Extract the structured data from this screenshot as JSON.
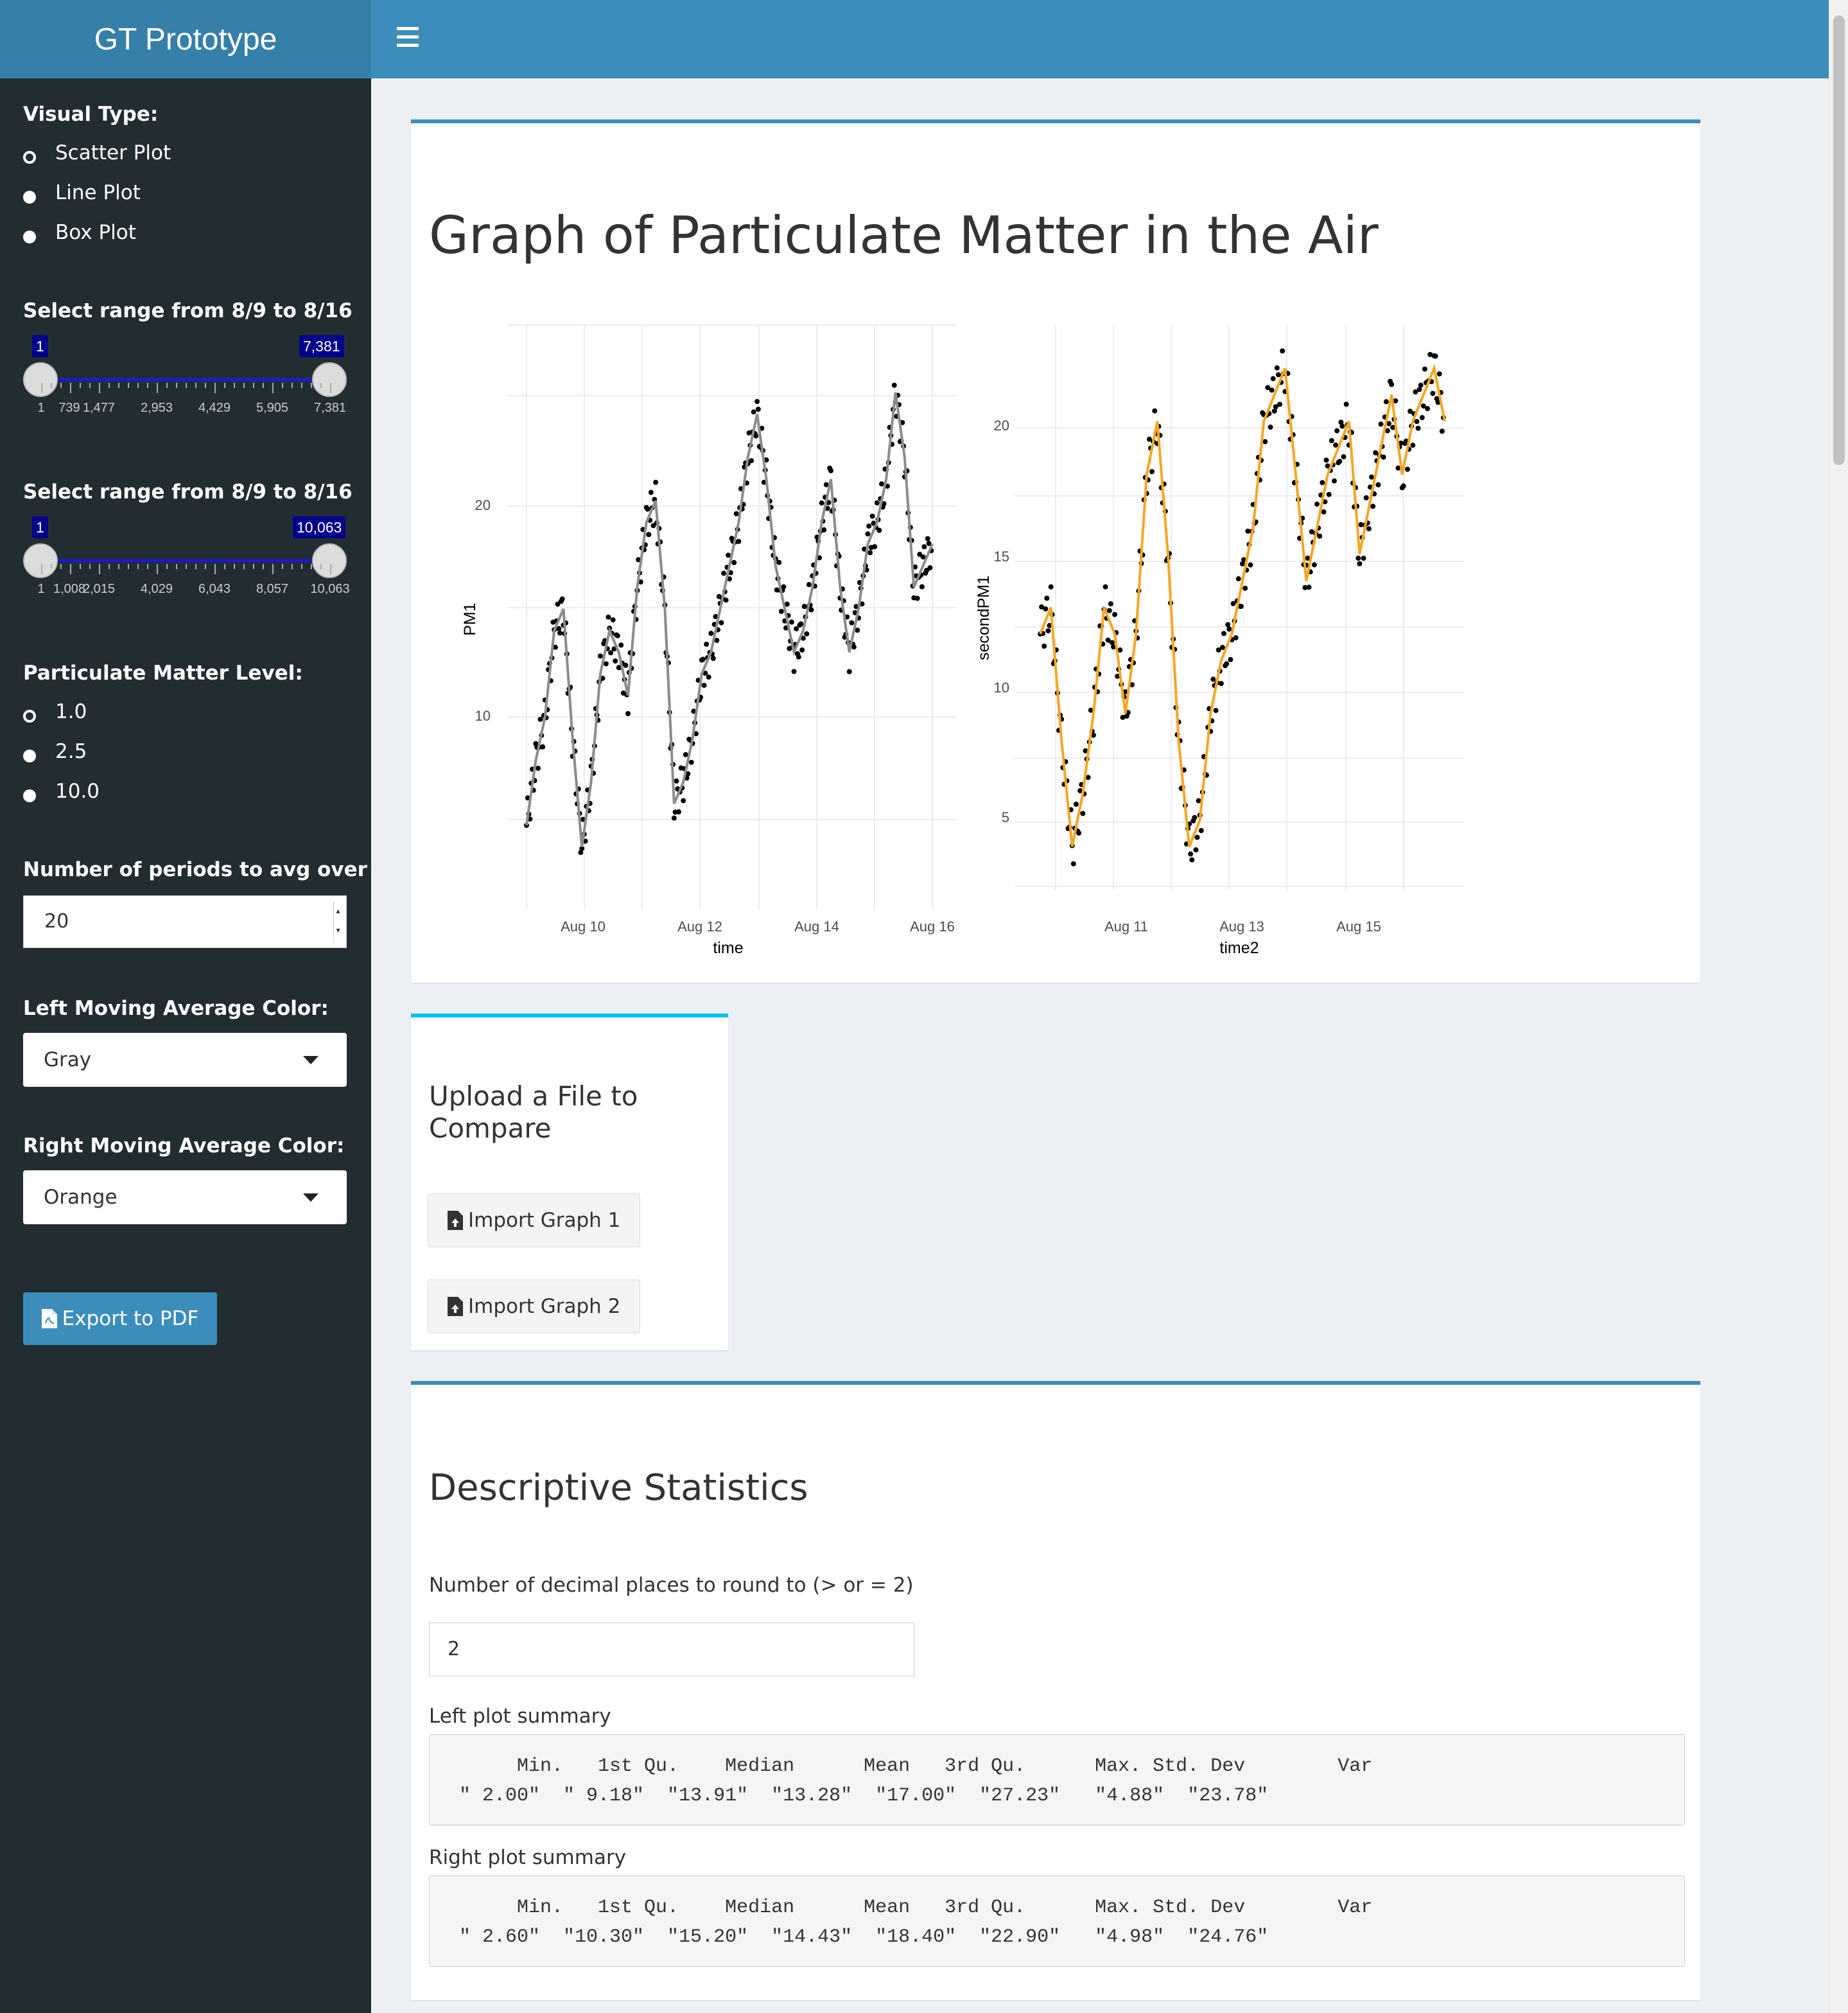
{
  "header": {
    "brand": "GT Prototype",
    "menu_icon": "hamburger-icon"
  },
  "sidebar": {
    "visual_type": {
      "label": "Visual Type:",
      "options": [
        "Scatter Plot",
        "Line Plot",
        "Box Plot"
      ],
      "selected": "Scatter Plot"
    },
    "range1": {
      "label": "Select range from 8/9 to 8/16",
      "min": "1",
      "max": "7,381",
      "ticks": [
        "1",
        "739",
        "1,477",
        "2,953",
        "4,429",
        "5,905",
        "7,381"
      ]
    },
    "range2": {
      "label": "Select range from 8/9 to 8/16",
      "min": "1",
      "max": "10,063",
      "ticks": [
        "1",
        "1,008",
        "2,015",
        "4,029",
        "6,043",
        "8,057",
        "10,063"
      ]
    },
    "pm_level": {
      "label": "Particulate Matter Level:",
      "options": [
        "1.0",
        "2.5",
        "10.0"
      ],
      "selected": "1.0"
    },
    "periods": {
      "label": "Number of periods to avg over",
      "value": "20"
    },
    "left_color": {
      "label": "Left Moving Average Color:",
      "value": "Gray"
    },
    "right_color": {
      "label": "Right Moving Average Color:",
      "value": "Orange"
    },
    "export_button": "Export to PDF"
  },
  "graph_box": {
    "title": "Graph of Particulate Matter in the Air",
    "left_plot": {
      "ylabel": "PM1",
      "xlabel": "time",
      "yticks": [
        "10",
        "20"
      ],
      "xticks": [
        "Aug 10",
        "Aug 12",
        "Aug 14",
        "Aug 16"
      ]
    },
    "right_plot": {
      "ylabel": "secondPM1",
      "xlabel": "time2",
      "yticks": [
        "5",
        "10",
        "15",
        "20"
      ],
      "xticks": [
        "Aug 11",
        "Aug 13",
        "Aug 15"
      ]
    }
  },
  "chart_data": [
    {
      "type": "scatter",
      "xlabel": "time",
      "ylabel": "PM1",
      "x_range": [
        "Aug 9",
        "Aug 16"
      ],
      "ylim": [
        2,
        27.23
      ],
      "series": [
        {
          "values": [
            5,
            8,
            10,
            14,
            15,
            9,
            4,
            7,
            12,
            14,
            13,
            11,
            16,
            19,
            20,
            15,
            6,
            7,
            9,
            12,
            13,
            15,
            17,
            19,
            22,
            24,
            21,
            17,
            15,
            13,
            14,
            16,
            19,
            21,
            16,
            13,
            15,
            18,
            19,
            21,
            25,
            22,
            16,
            17,
            18
          ]
        }
      ],
      "moving_average_color": "Gray"
    },
    {
      "type": "scatter",
      "xlabel": "time2",
      "ylabel": "secondPM1",
      "x_range": [
        "Aug 10",
        "Aug 16"
      ],
      "ylim": [
        2.6,
        22.9
      ],
      "series": [
        {
          "values": [
            12,
            13,
            8,
            4,
            6,
            9,
            13,
            12,
            9,
            12,
            18,
            20,
            15,
            8,
            4,
            5,
            9,
            11,
            12,
            14,
            16,
            20,
            21,
            22,
            18,
            14,
            16,
            18,
            19,
            20,
            15,
            17,
            19,
            21,
            18,
            20,
            21,
            22,
            20
          ]
        }
      ],
      "moving_average_color": "Orange"
    }
  ],
  "upload_box": {
    "title": "Upload a File to Compare",
    "button1": "Import Graph 1",
    "button2": "Import Graph 2"
  },
  "stats_box": {
    "title": "Descriptive Statistics",
    "round_label": "Number of decimal places to round to (> or = 2)",
    "round_value": "2",
    "left_label": "Left plot summary",
    "left_header": "     Min.   1st Qu.    Median      Mean   3rd Qu.      Max. Std. Dev        Var",
    "left_values": "\" 2.00\"  \" 9.18\"  \"13.91\"  \"13.28\"  \"17.00\"  \"27.23\"   \"4.88\"  \"23.78\"",
    "right_label": "Right plot summary",
    "right_header": "     Min.   1st Qu.    Median      Mean   3rd Qu.      Max. Std. Dev        Var",
    "right_values": "\" 2.60\"  \"10.30\"  \"15.20\"  \"14.43\"  \"18.40\"  \"22.90\"   \"4.98\"  \"24.76\""
  },
  "colors": {
    "header": "#3c8dbc",
    "brand": "#367fa9",
    "sidebar": "#222d32",
    "primary_border": "#3c8dbc",
    "info_border": "#00c0ef",
    "left_ma": "#808080",
    "right_ma": "#ffa500"
  }
}
